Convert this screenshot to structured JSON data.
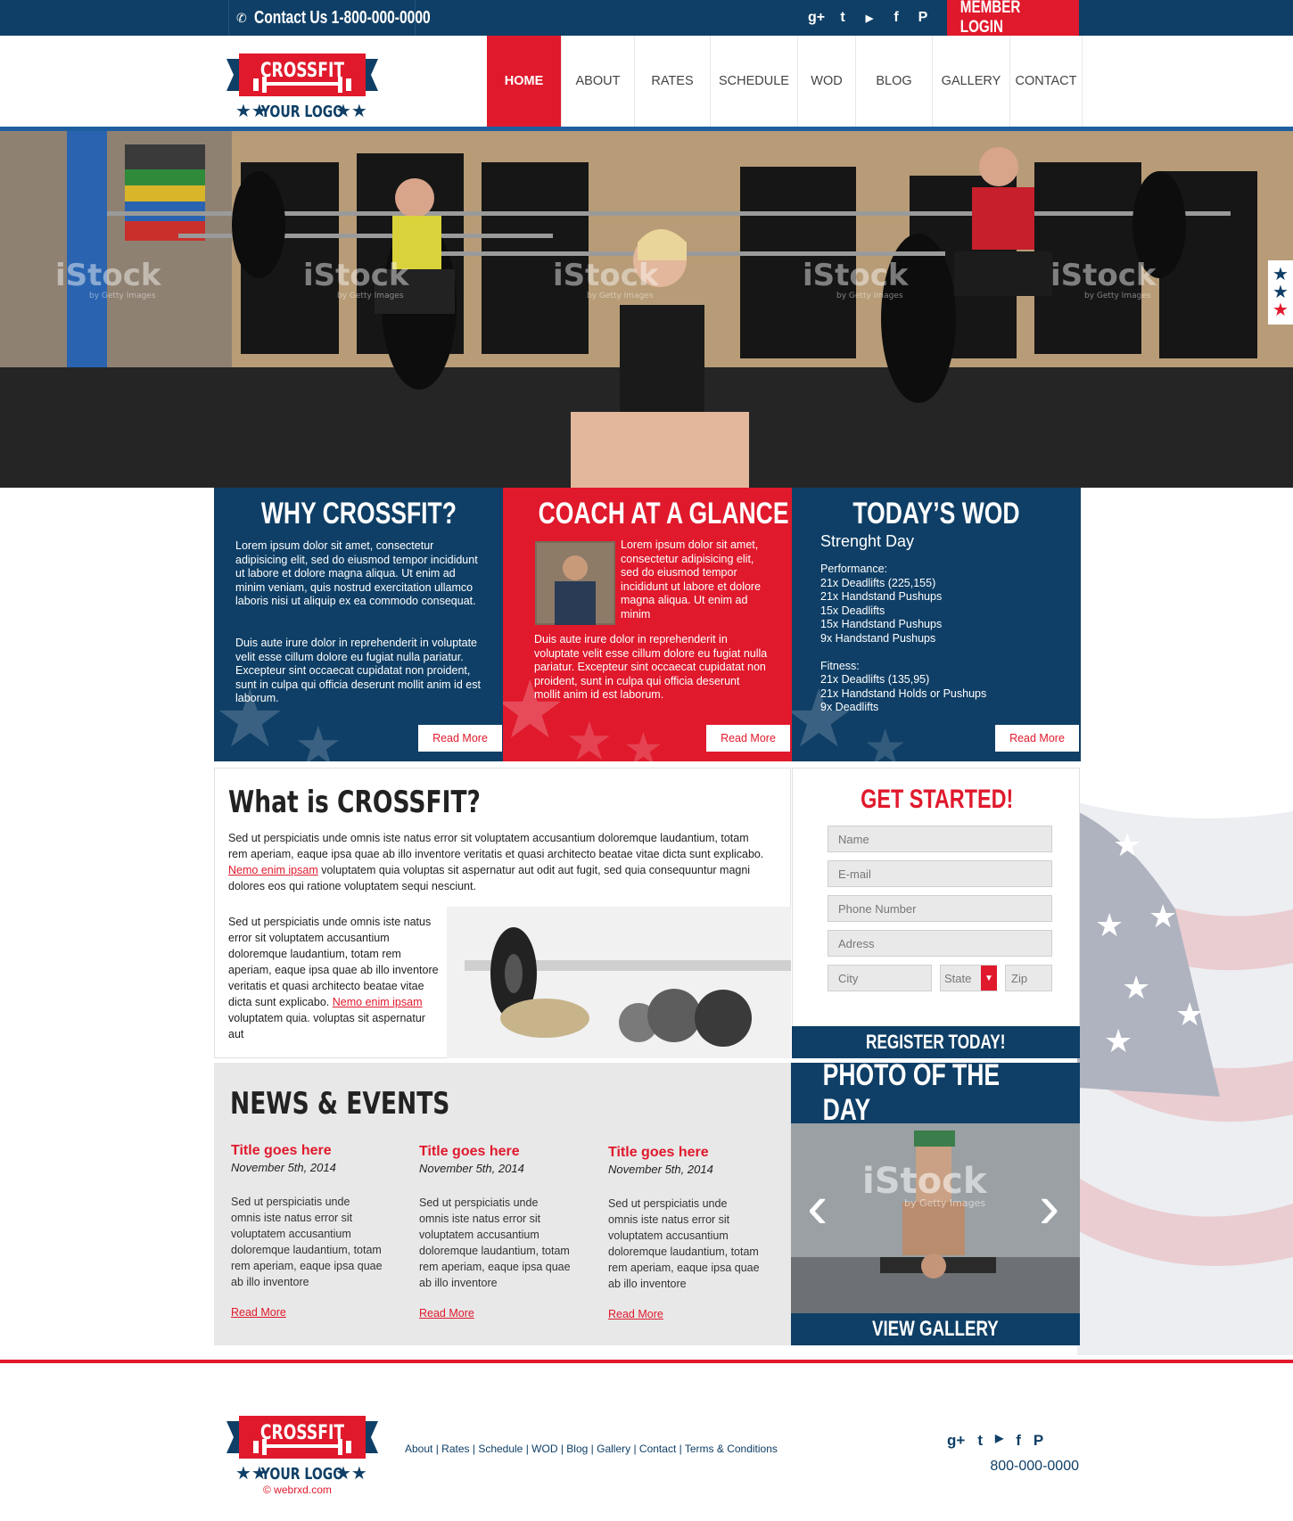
{
  "topbar": {
    "contact_label": "Contact Us 1-800-000-0000",
    "social_icons": [
      "google-plus-icon",
      "twitter-icon",
      "youtube-icon",
      "facebook-icon",
      "pinterest-icon"
    ],
    "social_glyphs": [
      "g+",
      "t",
      "▶",
      "f",
      "P"
    ],
    "member_login": "MEMBER LOGIN"
  },
  "logo": {
    "top_text": "CROSSFIT",
    "bottom_text": "YOUR LOGO"
  },
  "nav": {
    "items": [
      "HOME",
      "ABOUT",
      "RATES",
      "SCHEDULE",
      "WOD",
      "BLOG",
      "GALLERY",
      "CONTACT"
    ],
    "active": "HOME"
  },
  "hero": {
    "watermark": "iStock",
    "watermark_sub": "by Getty Images"
  },
  "boxes": {
    "why": {
      "title": "WHY CROSSFIT?",
      "p1": "Lorem ipsum dolor sit amet, consectetur adipisicing elit, sed do eiusmod tempor incididunt ut labore et dolore magna aliqua. Ut enim ad minim veniam, quis nostrud exercitation ullamco laboris nisi ut aliquip ex ea commodo consequat.",
      "p2": "Duis aute irure dolor in reprehenderit in voluptate velit esse cillum dolore eu fugiat nulla pariatur. Excepteur sint occaecat cupidatat non proident, sunt in culpa qui officia deserunt mollit anim id est laborum.",
      "read_more": "Read More"
    },
    "coach": {
      "title": "COACH AT A GLANCE",
      "p1": "Lorem ipsum dolor sit amet, consectetur adipisicing elit, sed do eiusmod tempor incididunt ut labore et dolore magna aliqua. Ut enim ad minim",
      "p2": "Duis aute irure dolor in reprehenderit in voluptate velit esse cillum dolore eu fugiat nulla pariatur. Excepteur sint occaecat cupidatat non proident, sunt in culpa qui officia deserunt mollit anim id est laborum.",
      "read_more": "Read More"
    },
    "wod": {
      "title": "TODAY’S WOD",
      "subtitle": "Strenght Day",
      "performance_label": "Performance:",
      "performance": [
        "21x Deadlifts (225,155)",
        "21x Handstand Pushups",
        "15x Deadlifts",
        "15x Handstand Pushups",
        "9x Handstand Pushups"
      ],
      "fitness_label": "Fitness:",
      "fitness": [
        "21x Deadlifts (135,95)",
        "21x Handstand Holds or Pushups",
        "9x Deadlifts"
      ],
      "read_more": "Read More"
    }
  },
  "what": {
    "title": "What is CROSSFIT?",
    "p1_a": "Sed ut perspiciatis unde omnis iste natus error sit voluptatem accusantium doloremque laudantium, totam rem aperiam, eaque ipsa quae ab illo inventore veritatis et quasi architecto beatae vitae dicta sunt explicabo.",
    "p1_link": "Nemo enim ipsam",
    "p1_b": "voluptatem quia voluptas sit aspernatur aut odit aut fugit, sed quia consequuntur magni dolores eos qui ratione voluptatem sequi nesciunt.",
    "p2_a": "Sed ut perspiciatis unde omnis iste natus error sit voluptatem accusantium doloremque laudantium, totam rem aperiam, eaque ipsa quae ab illo inventore veritatis et quasi architecto beatae vitae dicta sunt explicabo.",
    "p2_link": "Nemo enim ipsam",
    "p2_b": "voluptatem quia. voluptas sit aspernatur aut"
  },
  "form": {
    "title": "GET STARTED!",
    "name": "Name",
    "email": "E-mail",
    "phone": "Phone Number",
    "address": "Adress",
    "city": "City",
    "state": "State",
    "zip": "Zip",
    "submit": "REGISTER TODAY!"
  },
  "news": {
    "title": "NEWS & EVENTS",
    "items": [
      {
        "title": "Title goes here",
        "date": "November 5th, 2014",
        "body": "Sed ut perspiciatis unde omnis iste natus error sit voluptatem accusantium doloremque laudantium, totam rem aperiam, eaque ipsa quae ab illo inventore",
        "read_more": "Read More"
      },
      {
        "title": "Title goes here",
        "date": "November 5th, 2014",
        "body": "Sed ut perspiciatis unde omnis iste natus error sit voluptatem accusantium doloremque laudantium, totam rem aperiam, eaque ipsa quae ab illo inventore",
        "read_more": "Read More"
      },
      {
        "title": "Title goes here",
        "date": "November 5th, 2014",
        "body": "Sed ut perspiciatis unde omnis iste natus error sit voluptatem accusantium doloremque laudantium, totam rem aperiam, eaque ipsa quae ab illo inventore",
        "read_more": "Read More"
      }
    ]
  },
  "photo": {
    "title": "PHOTO OF THE DAY",
    "view_gallery": "VIEW GALLERY",
    "prev": "‹",
    "next": "›"
  },
  "footer": {
    "links": [
      "About",
      "Rates",
      "Schedule",
      "WOD",
      "Blog",
      "Gallery",
      "Contact",
      "Terms & Conditions"
    ],
    "copyright": "© webrxd.com",
    "phone": "800-000-0000"
  },
  "colors": {
    "brand_blue": "#0f3f66",
    "brand_red": "#e0192c"
  }
}
